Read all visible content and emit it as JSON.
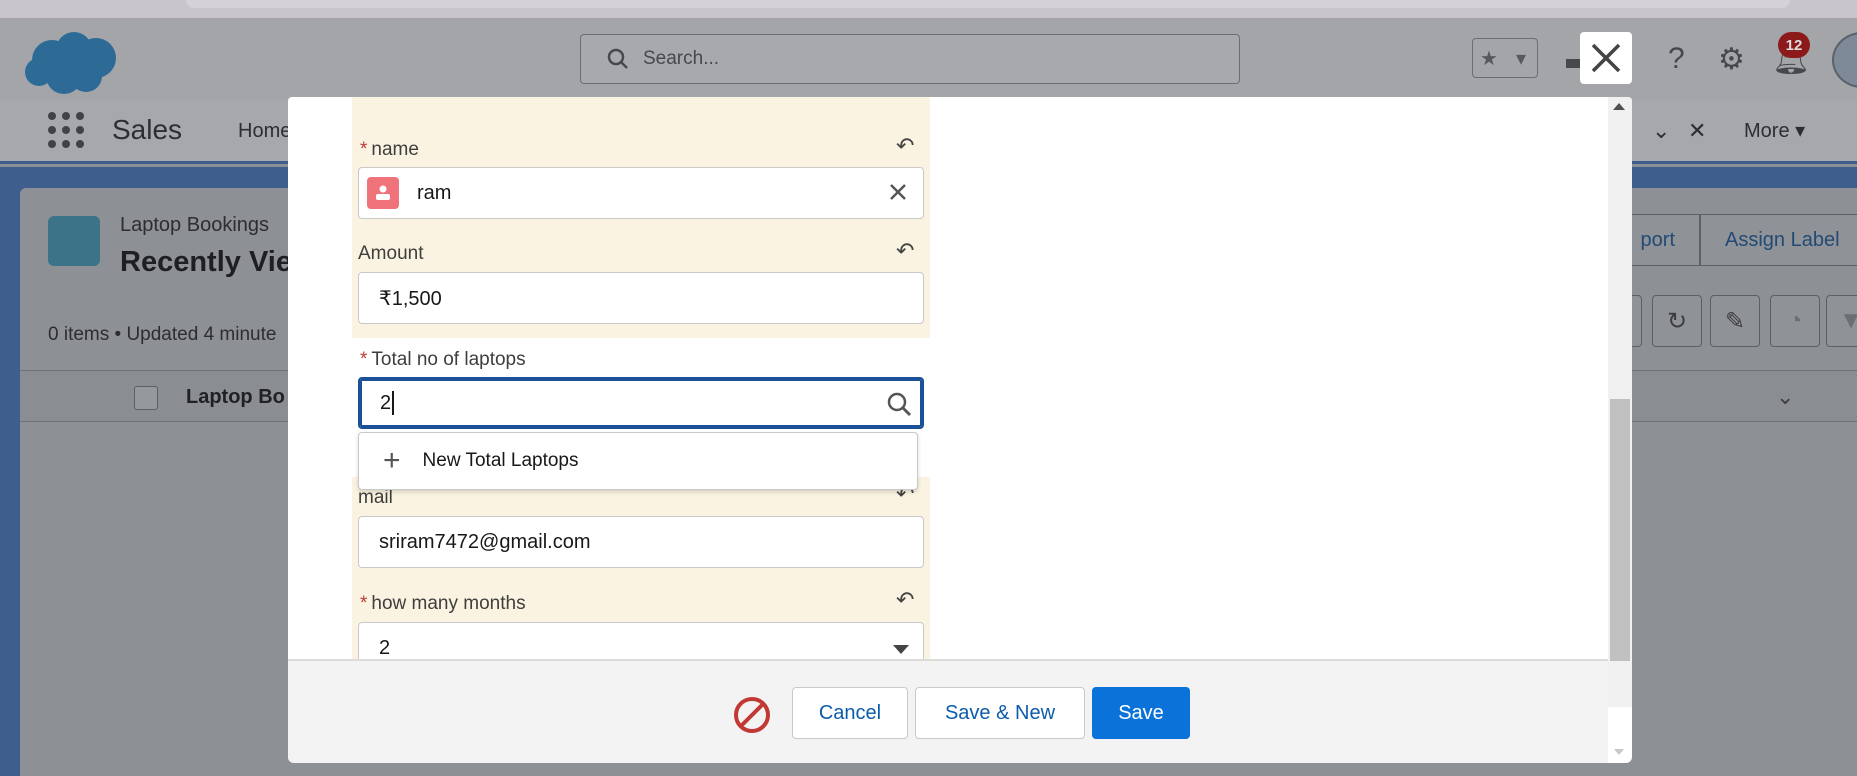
{
  "background": {
    "search_placeholder": "Search...",
    "notification_count": "12",
    "app_name": "Sales",
    "nav_home": "Home",
    "nav_more": "More",
    "object_label": "Laptop Bookings",
    "list_view_title": "Recently Vie",
    "list_meta": "0 items • Updated 4 minute",
    "actions": [
      "port",
      "Assign Label"
    ],
    "table_column": "Laptop Bo"
  },
  "form": {
    "name_label": "name",
    "name_value": "ram",
    "amount_label": "Amount",
    "amount_value": "₹1,500",
    "total_laptops_label": "Total no of laptops",
    "total_laptops_value": "2",
    "lookup_option": "New Total Laptops",
    "mail_label": "mail",
    "mail_value": "sriram7472@gmail.com",
    "months_label": "how many months",
    "months_value": "2"
  },
  "footer": {
    "cancel_label": "Cancel",
    "save_new_label": "Save & New",
    "save_label": "Save"
  },
  "colors": {
    "changed_field_bg": "#faf3e1",
    "brand_button": "#0b72d9",
    "focus_border": "#1b5297",
    "error_icon": "#c23934"
  }
}
